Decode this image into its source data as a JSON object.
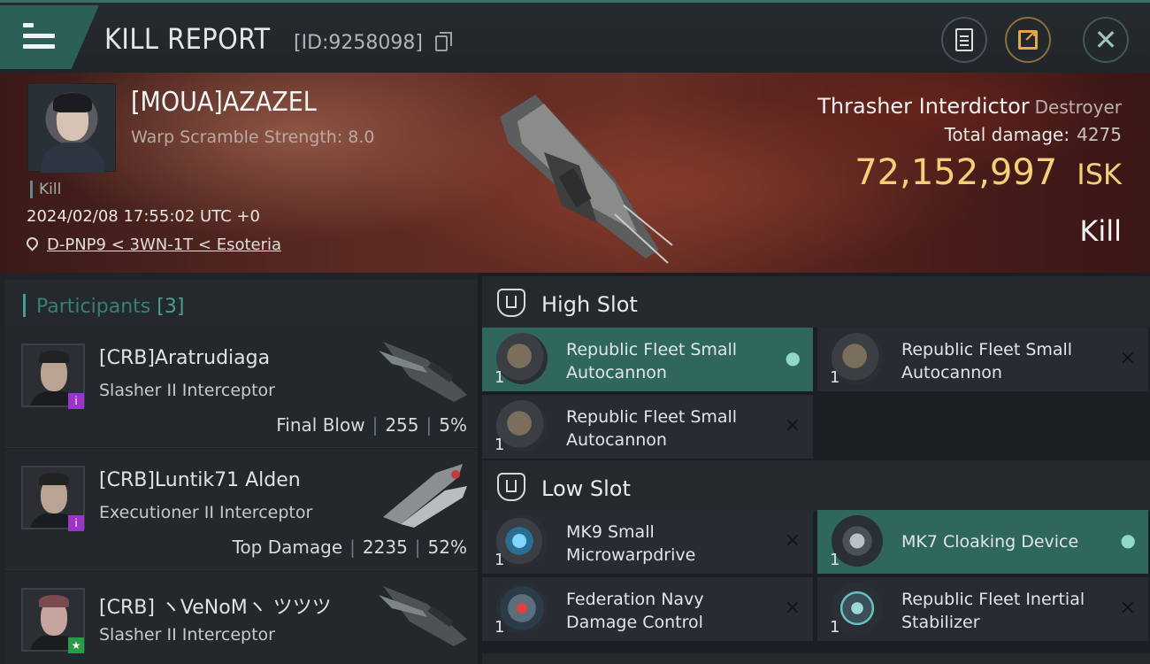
{
  "header": {
    "title": "KILL REPORT",
    "report_id": "[ID:9258098]"
  },
  "victim": {
    "name": "[MOUA]AZAZEL",
    "warp_scramble": "Warp Scramble Strength: 8.0",
    "tag": "Kill",
    "datetime": "2024/02/08 17:55:02 UTC +0",
    "location": "D-PNP9 < 3WN-1T < Esoteria",
    "ship_name": "Thrasher Interdictor",
    "ship_class": "Destroyer",
    "total_damage_label": "Total damage:",
    "total_damage": "4275",
    "isk_value": "72,152,997",
    "isk_unit": "ISK",
    "result": "Kill"
  },
  "participants": {
    "label": "Participants",
    "count": "[3]",
    "rows": [
      {
        "name": "[CRB]Aratrudiaga",
        "ship": "Slasher II Interceptor",
        "role": "Final Blow",
        "damage": "255",
        "percent": "5%"
      },
      {
        "name": "[CRB]Luntik71 Alden",
        "ship": "Executioner II Interceptor",
        "role": "Top Damage",
        "damage": "2235",
        "percent": "52%"
      },
      {
        "name": "[CRB] ヽVeNoMヽ ツツツ",
        "ship": "Slasher II Interceptor",
        "role": "",
        "damage": "",
        "percent": ""
      }
    ]
  },
  "slots": {
    "high": {
      "title": "High Slot",
      "modules": [
        {
          "qty": "1",
          "name": "Republic Fleet Small Autocannon",
          "status": "person"
        },
        {
          "qty": "1",
          "name": "Republic Fleet Small Autocannon",
          "status": "×"
        },
        {
          "qty": "1",
          "name": "Republic Fleet Small Autocannon",
          "status": "×"
        }
      ]
    },
    "low": {
      "title": "Low Slot",
      "modules": [
        {
          "qty": "1",
          "name": "MK9 Small Microwarpdrive",
          "status": "×"
        },
        {
          "qty": "1",
          "name": "MK7 Cloaking Device",
          "status": "person"
        },
        {
          "qty": "1",
          "name": "Federation Navy Damage Control",
          "status": "×"
        },
        {
          "qty": "1",
          "name": "Republic Fleet Inertial Stabilizer",
          "status": "×"
        }
      ]
    }
  },
  "colors": {
    "accent": "#2f675e",
    "isk": "#f6cf78",
    "final_blow_badge": "#9b35c9",
    "third_badge": "#2a9b45"
  }
}
